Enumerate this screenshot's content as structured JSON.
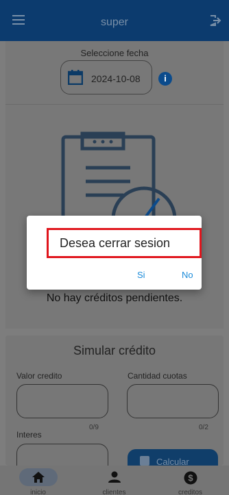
{
  "header": {
    "title": "super",
    "menu_icon": "hamburger-menu-icon",
    "logout_icon": "logout-icon"
  },
  "date_picker": {
    "label": "Seleccione fecha",
    "value": "2024-10-08",
    "icon": "calendar-icon"
  },
  "info_icon_glyph": "i",
  "empty_state": {
    "message": "No hay créditos pendientes.",
    "illustration": "clipboard-clock-icon"
  },
  "simulator": {
    "title": "Simular crédito",
    "valor_credito": {
      "label": "Valor credito",
      "value": "",
      "counter": "0/9"
    },
    "cantidad_cuotas": {
      "label": "Cantidad cuotas",
      "value": "",
      "counter": "0/2"
    },
    "interes": {
      "label": "Interes",
      "value": ""
    },
    "calculate_label": "Calcular"
  },
  "bottom_nav": {
    "items": [
      {
        "label": "inicio",
        "icon": "home-icon",
        "active": true
      },
      {
        "label": "clientes",
        "icon": "person-icon",
        "active": false
      },
      {
        "label": "creditos",
        "icon": "dollar-icon",
        "active": false
      }
    ]
  },
  "dialog": {
    "title": "Desea cerrar sesion",
    "yes_label": "Si",
    "no_label": "No"
  },
  "colors": {
    "primary": "#0b4b8c",
    "accent": "#1a8bd9",
    "highlight": "#e0151c"
  }
}
